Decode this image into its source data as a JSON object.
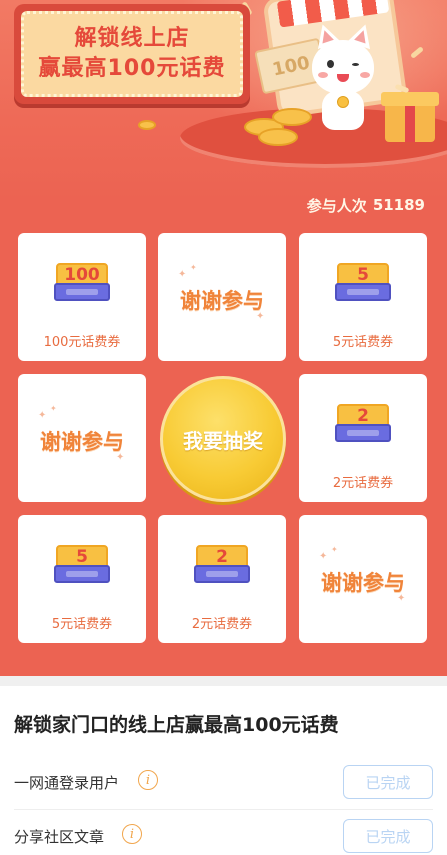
{
  "banner": {
    "line1": "解锁线上店",
    "line2": "赢最高100元话费",
    "bill_amount": "100"
  },
  "board": {
    "participants_label": "参与人次",
    "participants_count": "51189",
    "draw_button": "我要抽奖",
    "cells": [
      {
        "type": "voucher",
        "amount": "100",
        "label": "100元话费券"
      },
      {
        "type": "thanks",
        "text": "谢谢参与"
      },
      {
        "type": "voucher",
        "amount": "5",
        "label": "5元话费券"
      },
      {
        "type": "thanks",
        "text": "谢谢参与"
      },
      {
        "type": "voucher",
        "amount": "2",
        "label": "2元话费券"
      },
      {
        "type": "voucher",
        "amount": "5",
        "label": "5元话费券"
      },
      {
        "type": "voucher",
        "amount": "2",
        "label": "2元话费券"
      },
      {
        "type": "thanks",
        "text": "谢谢参与"
      }
    ]
  },
  "tasks": {
    "title": "解锁家门口的线上店赢最高100元话费",
    "items": [
      {
        "label": "一网通登录用户",
        "status": "已完成"
      },
      {
        "label": "分享社区文章",
        "status": "已完成"
      }
    ]
  },
  "colors": {
    "background_red": "#ec6352",
    "gold": "#f8cb35",
    "orange_text": "#f0843a",
    "done_border": "#b9d4f3"
  }
}
